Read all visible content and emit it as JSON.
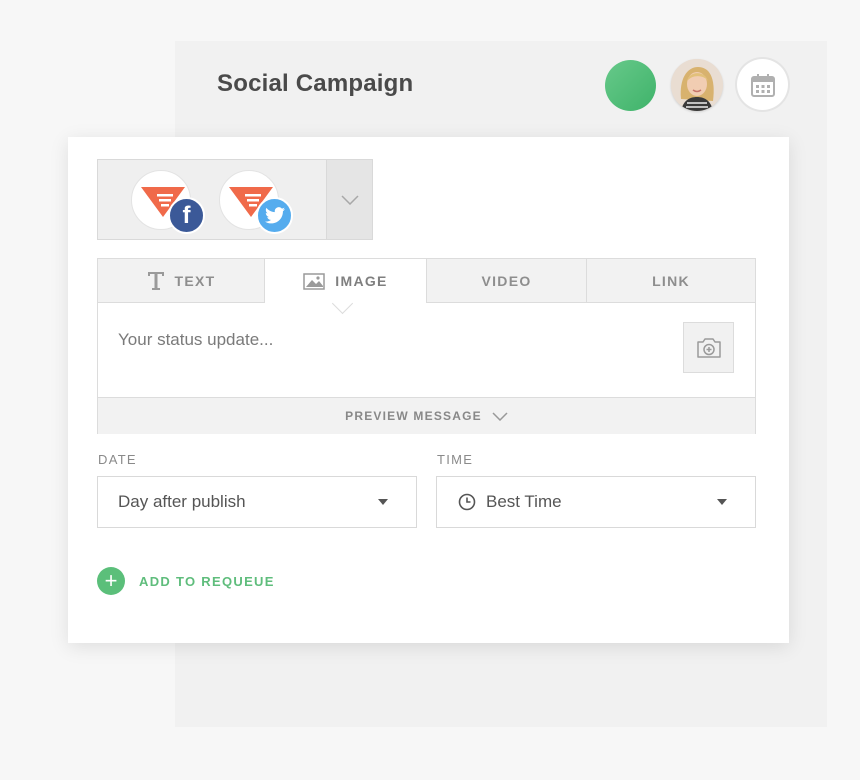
{
  "header": {
    "title": "Social Campaign",
    "status_color": "#4cbb74"
  },
  "accounts": [
    {
      "network": "facebook",
      "badge_text": "f",
      "badge_color": "#3b5998",
      "logo_color": "#f06a4a"
    },
    {
      "network": "twitter",
      "badge_color": "#55acee",
      "logo_color": "#f06a4a"
    }
  ],
  "tabs": [
    {
      "label": "TEXT",
      "icon": "text-icon"
    },
    {
      "label": "IMAGE",
      "icon": "image-icon",
      "active": true
    },
    {
      "label": "VIDEO"
    },
    {
      "label": "LINK"
    }
  ],
  "composer": {
    "placeholder": "Your status update...",
    "preview_label": "PREVIEW MESSAGE"
  },
  "date": {
    "label": "DATE",
    "value": "Day after publish"
  },
  "time": {
    "label": "TIME",
    "value": "Best Time"
  },
  "requeue": {
    "label": "ADD TO REQUEUE",
    "color": "#5bbf7a"
  }
}
